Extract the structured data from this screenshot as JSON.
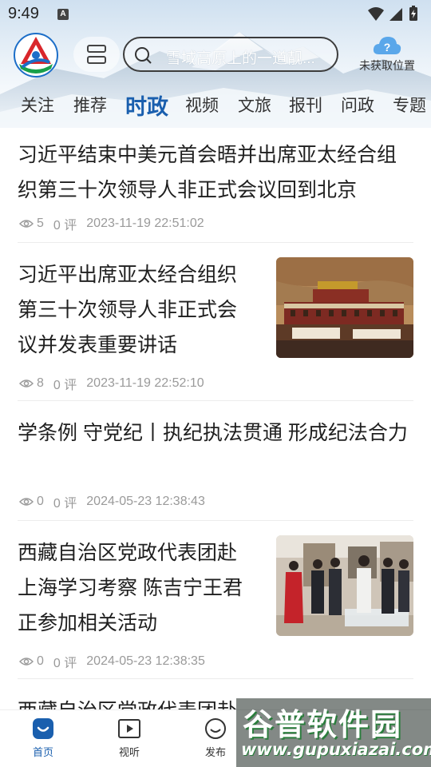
{
  "status_bar": {
    "time": "9:49",
    "notification_badge": "A"
  },
  "header": {
    "search_placeholder": "雪域高原上的一道靓...",
    "location_label": "未获取位置"
  },
  "tabs": [
    {
      "label": "关注",
      "active": false
    },
    {
      "label": "推荐",
      "active": false
    },
    {
      "label": "时政",
      "active": true
    },
    {
      "label": "视频",
      "active": false
    },
    {
      "label": "文旅",
      "active": false
    },
    {
      "label": "报刊",
      "active": false
    },
    {
      "label": "问政",
      "active": false
    },
    {
      "label": "专题",
      "active": false
    }
  ],
  "feed": [
    {
      "title": "习近平结束中美元首会晤并出席亚太经合组织第三十次领导人非正式会议回到北京",
      "views": "5",
      "comments": "0 评",
      "time": "2023-11-19 22:51:02"
    },
    {
      "title": "习近平出席亚太经合组织第三十次领导人非正式会议并发表重要讲话",
      "views": "8",
      "comments": "0 评",
      "time": "2023-11-19 22:52:10",
      "thumbnail": "tibet-monastery-photo"
    },
    {
      "title": "学条例 守党纪丨执纪执法贯通 形成纪法合力",
      "views": "0",
      "comments": "0 评",
      "time": "2024-05-23 12:38:43"
    },
    {
      "title": "西藏自治区党政代表团赴上海学习考察 陈吉宁王君正参加相关活动",
      "views": "0",
      "comments": "0 评",
      "time": "2024-05-23 12:38:35",
      "thumbnail": "delegation-visit-photo"
    },
    {
      "title": "西藏自治区党政代表团赴"
    }
  ],
  "bottom_nav": [
    {
      "label": "首页",
      "icon": "home-icon",
      "active": true
    },
    {
      "label": "视听",
      "icon": "video-icon",
      "active": false
    },
    {
      "label": "发布",
      "icon": "publish-icon",
      "active": false
    }
  ],
  "watermark": {
    "main": "谷普软件园",
    "url": "www.gupuxiazai.com"
  },
  "colors": {
    "accent": "#1a5fae",
    "meta_text": "#9a9a9a",
    "title_text": "#1f1f1f"
  }
}
